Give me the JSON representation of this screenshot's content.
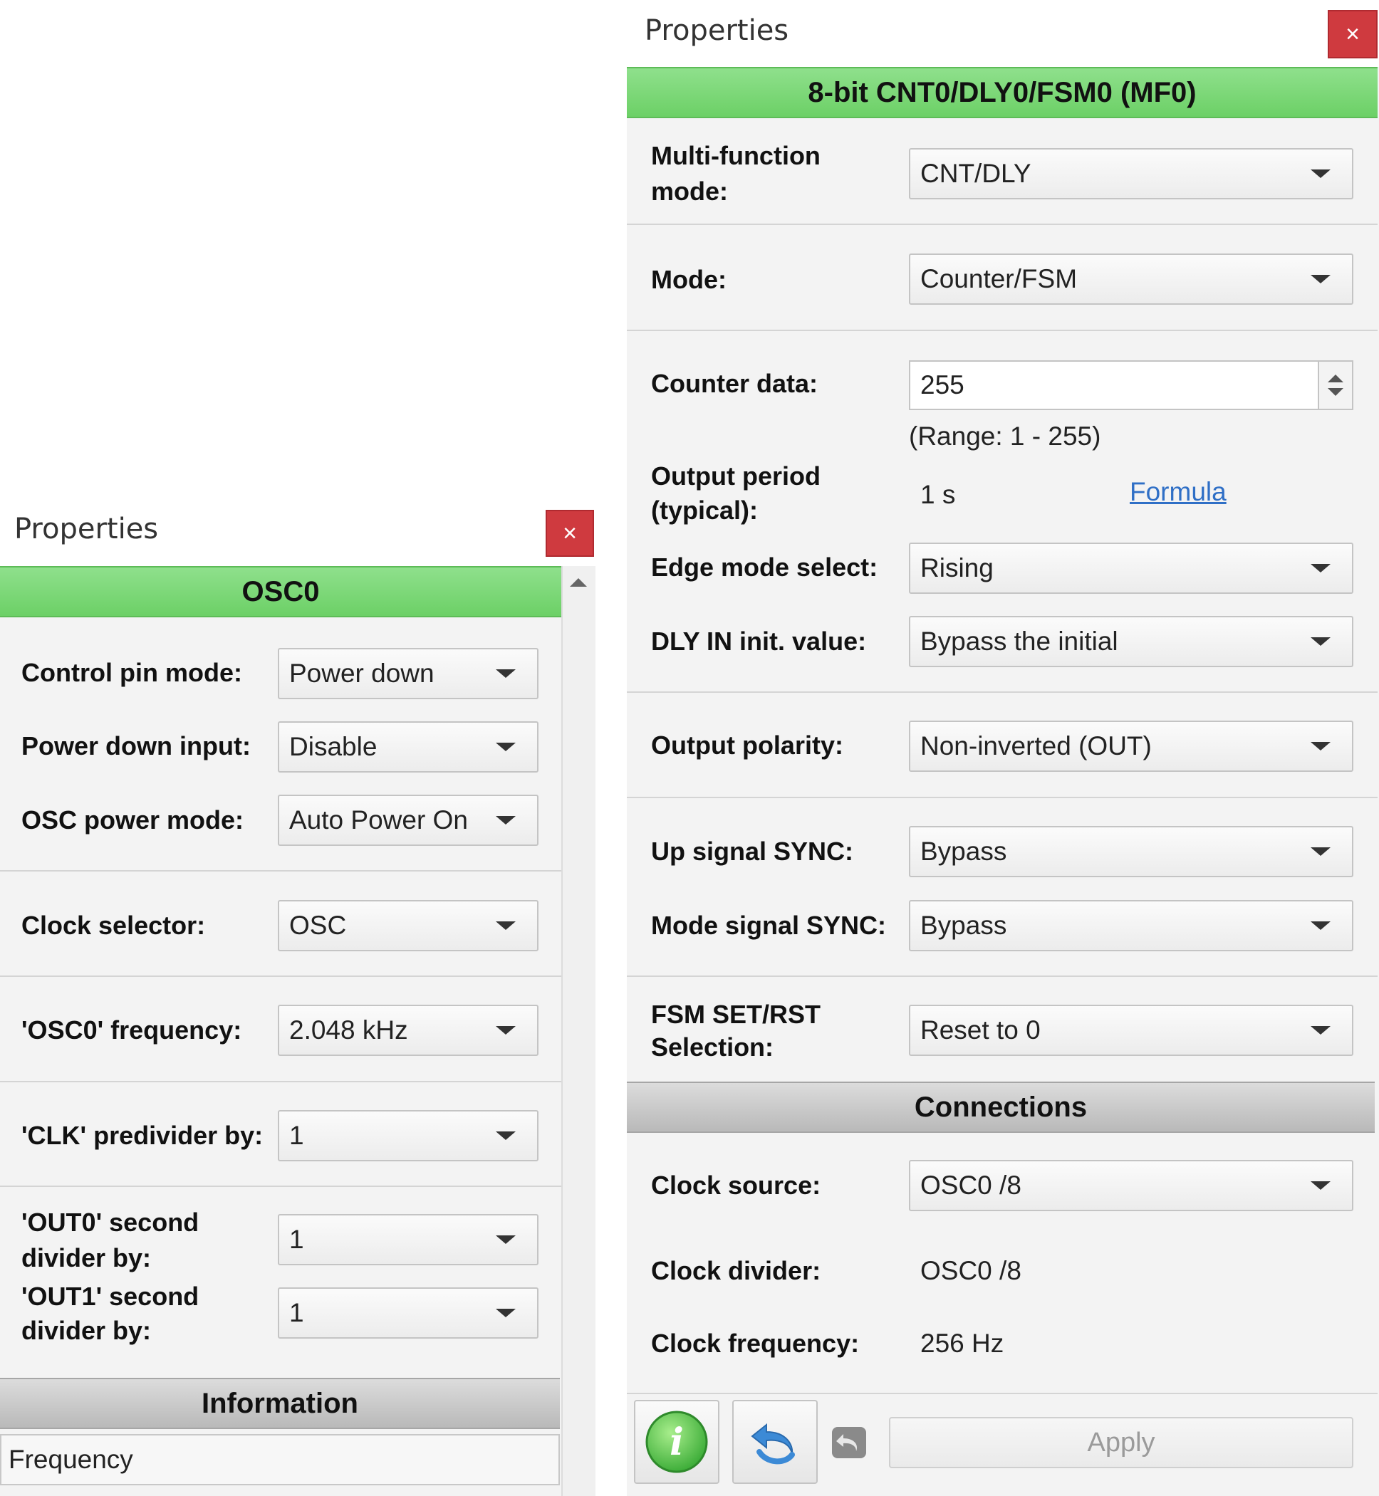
{
  "left": {
    "title": "Properties",
    "close": "×",
    "header": "OSC0",
    "rows": {
      "control_pin_mode": {
        "label": "Control pin mode:",
        "value": "Power down"
      },
      "power_down_input": {
        "label": "Power down input:",
        "value": "Disable"
      },
      "osc_power_mode": {
        "label": "OSC power mode:",
        "value": "Auto Power On"
      },
      "clock_selector": {
        "label": "Clock selector:",
        "value": "OSC"
      },
      "osc0_frequency": {
        "label": "'OSC0' frequency:",
        "value": "2.048 kHz"
      },
      "clk_predivider": {
        "label": "'CLK' predivider by:",
        "value": "1"
      },
      "out0_divider": {
        "label_line1": "'OUT0' second",
        "label_line2": "divider by:",
        "value": "1"
      },
      "out1_divider": {
        "label_line1": "'OUT1' second",
        "label_line2": "divider by:",
        "value": "1"
      }
    },
    "info_header": "Information",
    "frequency_label": "Frequency"
  },
  "right": {
    "title": "Properties",
    "close": "×",
    "header": "8-bit CNT0/DLY0/FSM0 (MF0)",
    "multi_function_mode": {
      "label_line1": "Multi-function",
      "label_line2": "mode:",
      "value": "CNT/DLY"
    },
    "mode": {
      "label": "Mode:",
      "value": "Counter/FSM"
    },
    "counter_data": {
      "label": "Counter data:",
      "value": "255",
      "range": "(Range:  1 - 255)"
    },
    "output_period": {
      "label_line1": "Output period",
      "label_line2": "(typical):",
      "value": "1 s",
      "link": "Formula"
    },
    "edge_mode": {
      "label": "Edge mode select:",
      "value": "Rising"
    },
    "dly_in_init": {
      "label": "DLY IN init. value:",
      "value": "Bypass the initial"
    },
    "output_polarity": {
      "label": "Output polarity:",
      "value": "Non-inverted (OUT)"
    },
    "up_signal_sync": {
      "label": "Up signal SYNC:",
      "value": "Bypass"
    },
    "mode_signal_sync": {
      "label": "Mode signal SYNC:",
      "value": "Bypass"
    },
    "fsm_set_rst": {
      "label_line1": "FSM SET/RST",
      "label_line2": "Selection:",
      "value": "Reset to 0"
    },
    "connections_header": "Connections",
    "clock_source": {
      "label": "Clock source:",
      "value": "OSC0 /8"
    },
    "clock_divider": {
      "label": "Clock divider:",
      "value": "OSC0 /8"
    },
    "clock_frequency": {
      "label": "Clock frequency:",
      "value": "256 Hz"
    },
    "apply_label": "Apply",
    "info_glyph": "i"
  },
  "colors": {
    "green_header": "#6cd066",
    "close_red": "#cf3a3f",
    "link_blue": "#2f6fc6"
  }
}
